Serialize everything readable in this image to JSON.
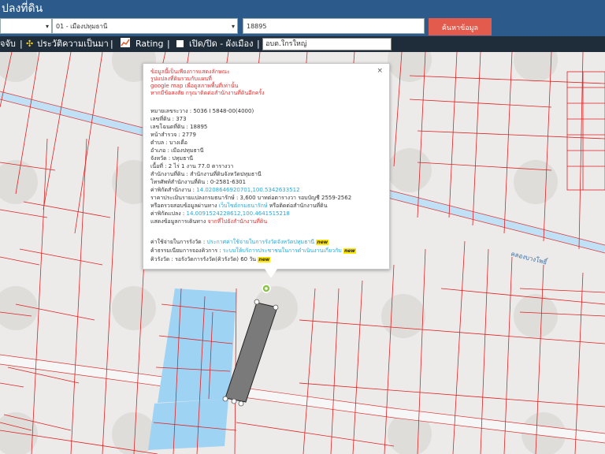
{
  "header": {
    "title": "ปลงที่ดิน"
  },
  "search": {
    "province_value": "",
    "district_value": "01 - เมืองปทุมธานี",
    "deed_value": "18895",
    "button_label": "ค้นหาข้อมูล"
  },
  "toolbar": {
    "item1": "จจับ",
    "sep1": "|",
    "history": "ประวัติความเป็นมา",
    "sep2": "|",
    "rating": "Rating",
    "sep3": "|",
    "toggle_zoning": "เปิด/ปิด - ผังเมือง",
    "sep4": "|",
    "zoning_input": "อบต.ใกรใหญ่"
  },
  "map": {
    "road_label": "คลองบางโพธิ์"
  },
  "popup": {
    "close": "×",
    "notice1": "ข้อมูลนี้เป็นเพียงการแสดงลักษณะ",
    "notice2": "รูปแปลงที่ดินรวมกับแผนที่",
    "notice3": "google map เพื่อดูสภาพพื้นที่เท่านั้น",
    "notice4": "หากมีข้อสงสัย กรุณาติดต่อสำนักงานที่ดินอีกครั้ง",
    "map_sheet": "หมายเลขระวาง : 5036 I 5848-00(4000)",
    "land_no": "เลขที่ดิน : 373",
    "deed_no": "เลขโฉนดที่ดิน : 18895",
    "survey_page": "หน้าสำรวจ : 2779",
    "subdistrict": "ตำบล : บางเดื่อ",
    "district": "อำเภอ : เมืองปทุมธานี",
    "province": "จังหวัด : ปทุมธานี",
    "area": "เนื้อที่ : 2 ไร่ 1 งาน 77.0 ตารางวา",
    "land_office_prefix": "สำนักงานที่ดิน : ",
    "land_office": "สำนักงานที่ดินจังหวัดปทุมธานี",
    "office_phone": "โทรศัพท์สำนักงานที่ดิน : 0-2581-6301",
    "office_coord_prefix": "ค่าพิกัดสำนักงาน : ",
    "office_coord": "14.0208646920701,100.5342633512",
    "appraisal": "ราคาประเมินรายแปลงกรมธนารักษ์ : 3,600 บาทต่อตารางวา รอบบัญชี 2559-2562",
    "check_prefix": "หรือตรวจสอบข้อมูลผ่านทาง ",
    "check_link": "เว็บไซต์กรมธนารักษ์",
    "check_suffix": " หรือติดต่อสำนักงานที่ดิน",
    "parcel_coord_prefix": "ค่าพิกัดแปลง : ",
    "parcel_coord": "14.0091524228612,100.4641515218",
    "route_prefix": "แสดงข้อมูลการเดินทาง ",
    "route_link": "จากที่ไปยังสำนักงานที่ดิน",
    "fee_prefix": "ค่าใช้จ่ายในการรังวัด : ",
    "fee_link": "ประกาศค่าใช้จ่ายในการรังวัดจังหวัดปทุมธานี",
    "booking_prefix": "ค้าธรรมเนียมการจองคิวการ : ",
    "booking_link": "ระบบให้บริการประชาชนในการดำเนินงานเกี่ยวกับ",
    "queue": "คิวรังวัด : รอรังวัดการรังวัด(คิวรังวัด) 60 วัน",
    "new_badge": "new"
  }
}
